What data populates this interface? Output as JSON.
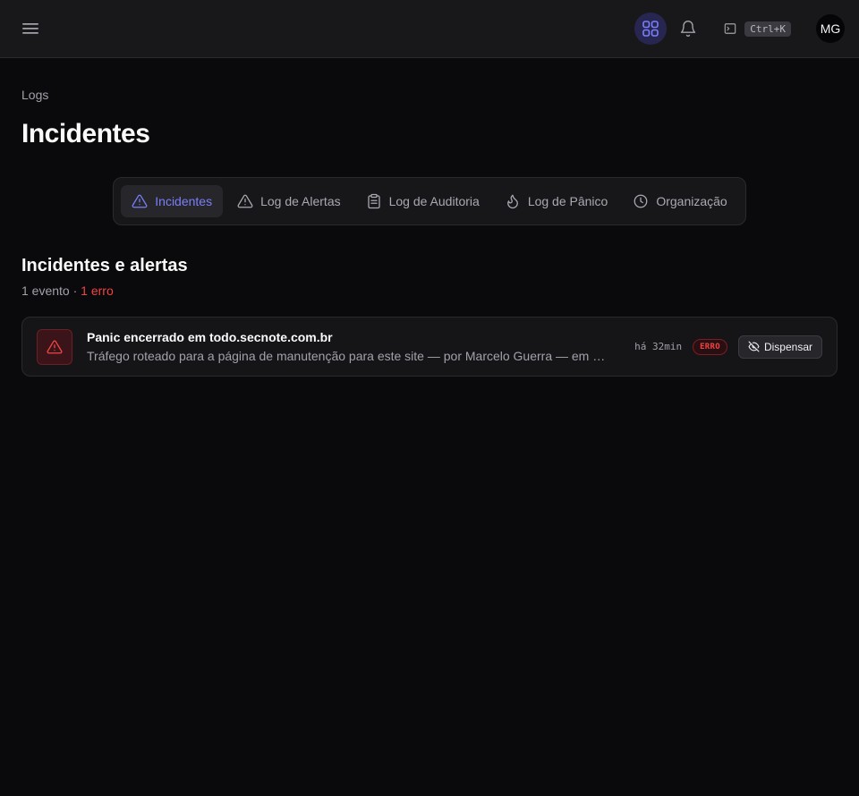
{
  "header": {
    "shortcut": "Ctrl+K",
    "avatar_initials": "MG",
    "accent_color": "#7b7ff7"
  },
  "breadcrumb": "Logs",
  "page_title": "Incidentes",
  "tabs": [
    {
      "label": "Incidentes",
      "icon": "warning-icon",
      "active": true
    },
    {
      "label": "Log de Alertas",
      "icon": "warning-icon",
      "active": false
    },
    {
      "label": "Log de Auditoria",
      "icon": "clipboard-icon",
      "active": false
    },
    {
      "label": "Log de Pânico",
      "icon": "flame-icon",
      "active": false
    },
    {
      "label": "Organização",
      "icon": "clock-icon",
      "active": false
    }
  ],
  "section": {
    "title": "Incidentes e alertas",
    "count": "1 evento",
    "separator": "·",
    "error_count": "1 erro"
  },
  "events": [
    {
      "title": "Panic encerrado em todo.secnote.com.br",
      "description": "Tráfego roteado para a página de manutenção para este site — por Marcelo Guerra — em andamento",
      "time": "há 32min",
      "badge": "ERRO",
      "dismiss_label": "Dispensar",
      "severity_color": "#ef4444"
    }
  ]
}
